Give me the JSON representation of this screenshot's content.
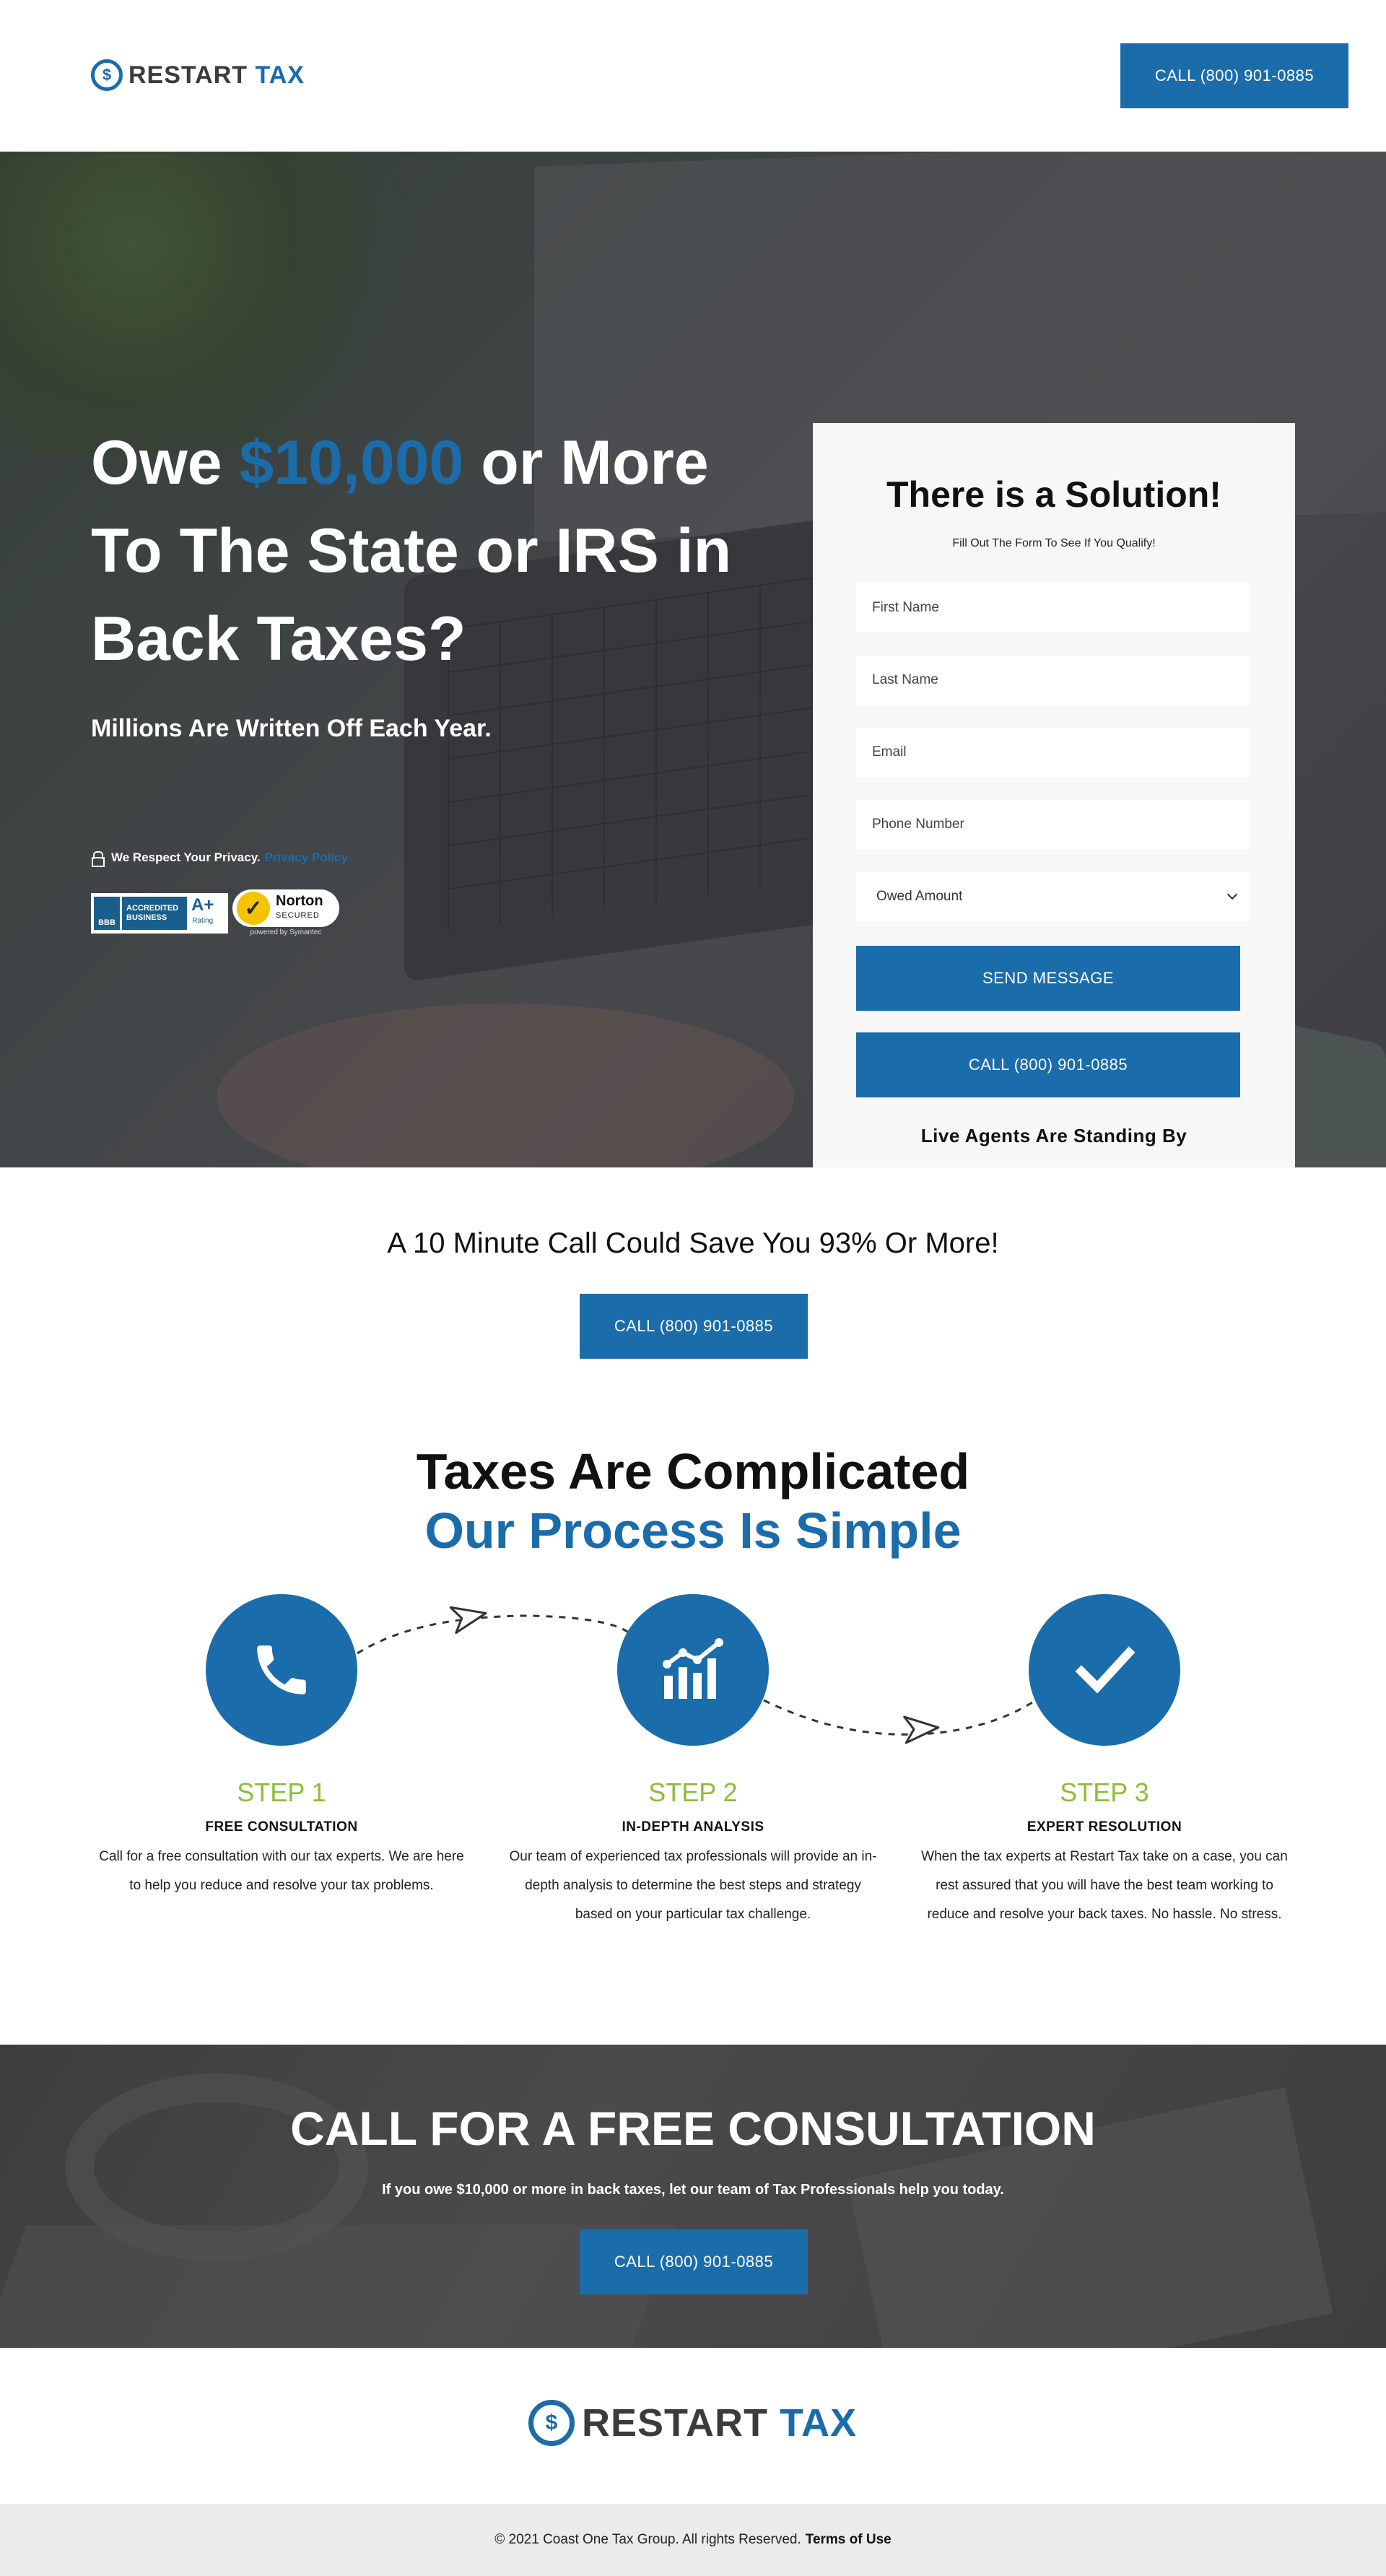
{
  "header": {
    "logo_word1": "RESTART",
    "logo_word2": "TAX",
    "logo_symbol": "$",
    "call_label": "CALL (800) 901-0885"
  },
  "hero": {
    "title_part1": "Owe ",
    "title_amount": "$10,000",
    "title_part2": " or More To The State or IRS in Back Taxes?",
    "subtitle": "Millions Are Written Off Each Year.",
    "privacy_text": "We Respect Your Privacy.",
    "privacy_link": "Privacy Policy",
    "bbb_logo": "BBB",
    "bbb_text": "ACCREDITED BUSINESS",
    "bbb_rating": "A+",
    "bbb_rating_label": "Rating",
    "norton_name": "Norton",
    "norton_secured": "SECURED",
    "norton_powered": "powered by Symantec"
  },
  "form": {
    "title": "There is a Solution!",
    "subtitle": "Fill Out The Form To See If You Qualify!",
    "first_name_placeholder": "First Name",
    "last_name_placeholder": "Last Name",
    "email_placeholder": "Email",
    "phone_placeholder": "Phone Number",
    "owed_amount_selected": "Owed Amount",
    "send_label": "SEND MESSAGE",
    "call_label": "CALL (800) 901-0885",
    "agents_text": "Live Agents Are Standing By"
  },
  "save": {
    "text": "A 10 Minute Call Could Save You 93% Or More!",
    "call_label": "CALL (800) 901-0885"
  },
  "process": {
    "title_line1": "Taxes Are Complicated",
    "title_line2": "Our Process Is Simple",
    "steps": [
      {
        "label": "STEP 1",
        "name": "FREE CONSULTATION",
        "description": "Call for a free consultation with our tax experts. We are here to help you reduce and resolve your tax problems.",
        "icon": "phone-icon"
      },
      {
        "label": "STEP 2",
        "name": "IN-DEPTH ANALYSIS",
        "description": "Our team of experienced tax professionals will provide an in-depth analysis to determine the best steps and strategy based on your particular tax challenge.",
        "icon": "chart-icon"
      },
      {
        "label": "STEP 3",
        "name": "EXPERT RESOLUTION",
        "description": "When the tax experts at Restart Tax take on a case, you can rest assured that you will have the best team working to reduce and resolve your back taxes. No hassle. No stress.",
        "icon": "checkmark-icon"
      }
    ]
  },
  "cta": {
    "title": "CALL FOR A FREE CONSULTATION",
    "subtitle": "If you owe $10,000 or more in back taxes, let our team of Tax Professionals help you today.",
    "call_label": "CALL (800) 901-0885"
  },
  "footer": {
    "copyright": "© 2021 Coast One Tax Group. All rights Reserved.",
    "terms_link": "Terms of Use"
  },
  "colors": {
    "brand_blue": "#1a6cab",
    "step_green": "#8bbd3b",
    "form_bg": "#f7f7f7",
    "footer_bg": "#ebebeb"
  }
}
